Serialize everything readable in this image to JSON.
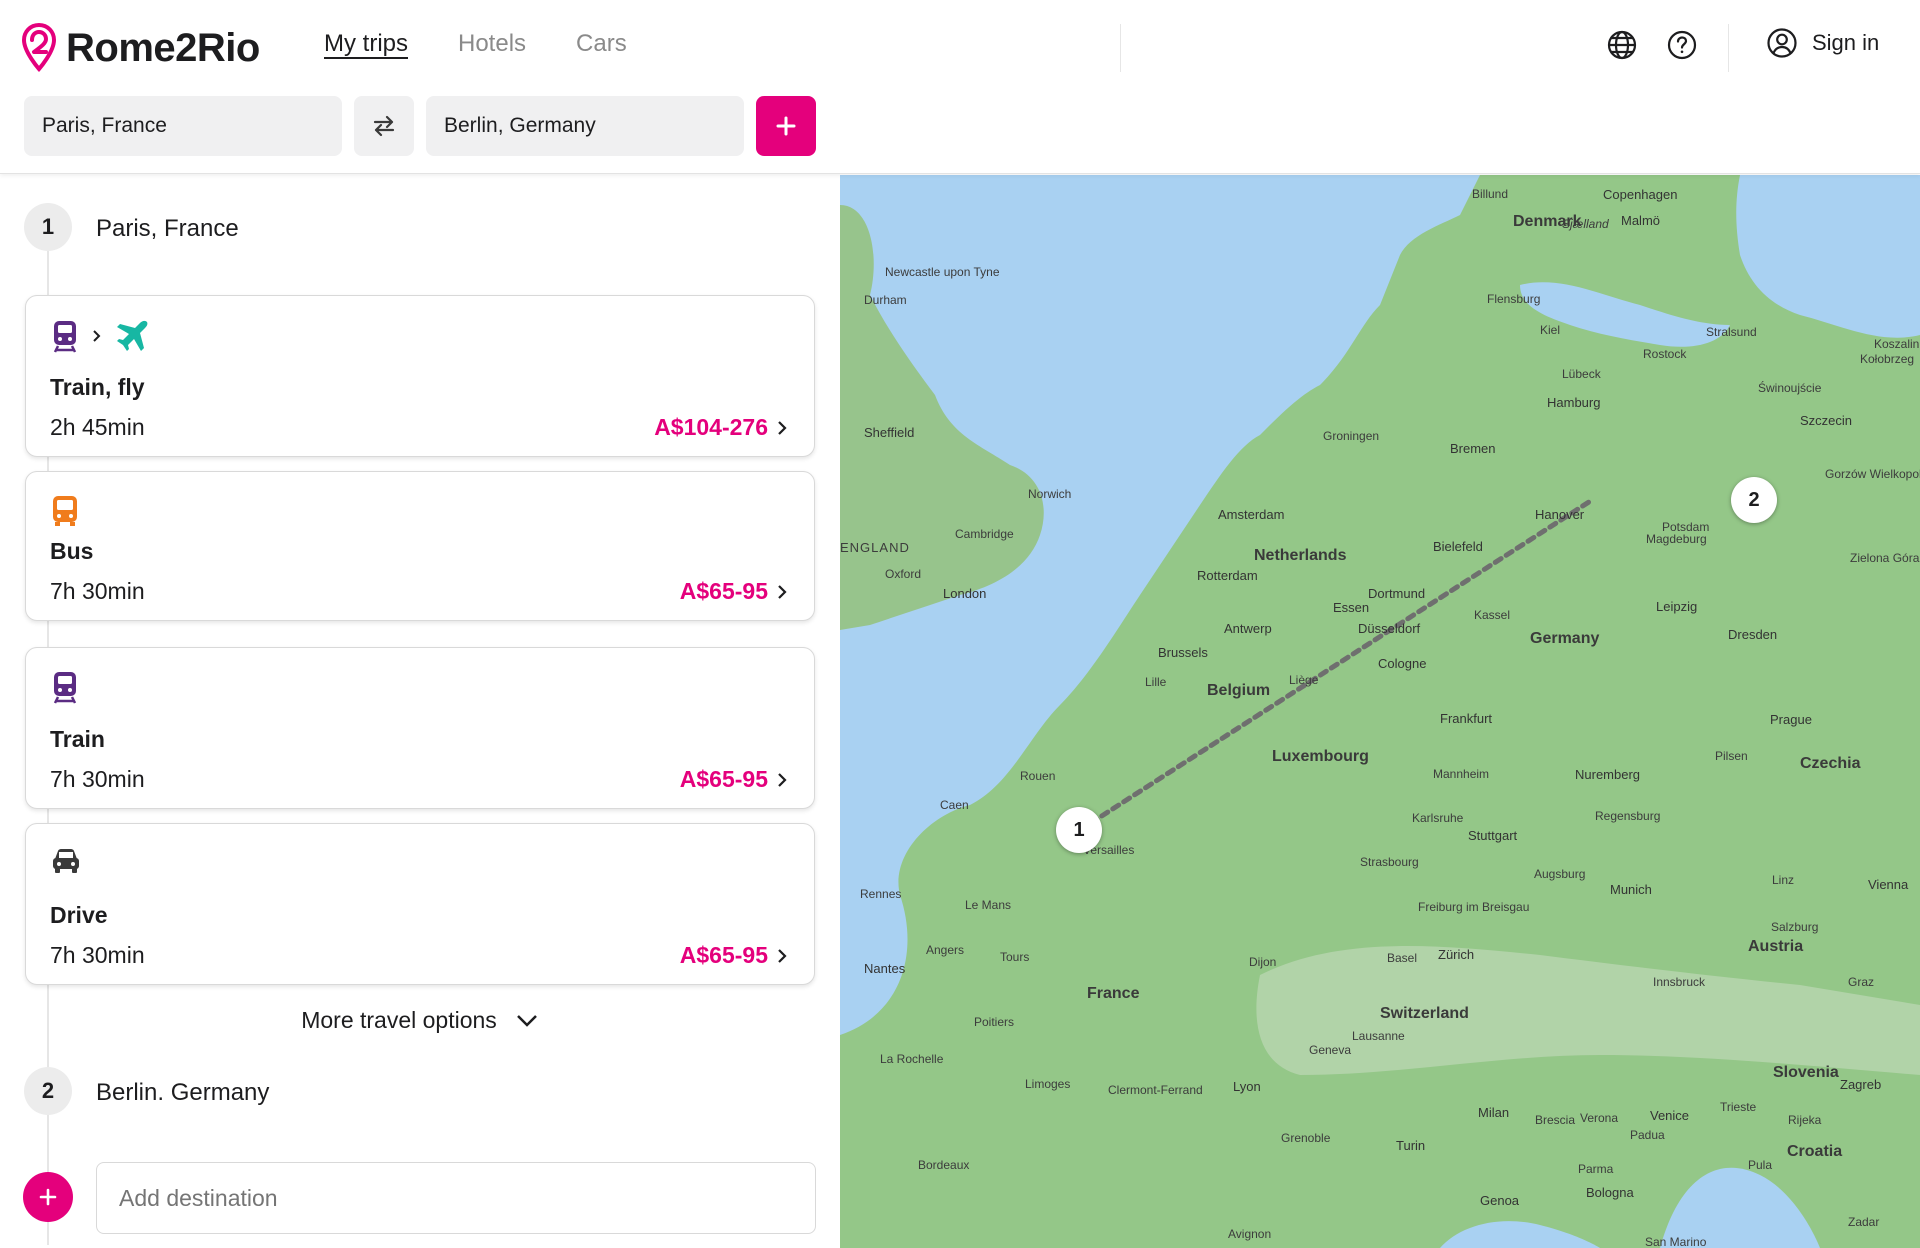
{
  "brand": {
    "name": "Rome2Rio",
    "accent": "#e4007c"
  },
  "nav": [
    {
      "label": "My trips",
      "active": true
    },
    {
      "label": "Hotels",
      "active": false
    },
    {
      "label": "Cars",
      "active": false
    }
  ],
  "header": {
    "sign_in_label": "Sign in"
  },
  "search": {
    "origin_value": "Paris, France",
    "destination_value": "Berlin, Germany"
  },
  "itinerary": {
    "stops": [
      {
        "number": "1",
        "name": "Paris, France"
      },
      {
        "number": "2",
        "name": "Berlin. Germany"
      }
    ],
    "options": [
      {
        "mode": "Train, fly",
        "duration": "2h 45min",
        "price": "A$104-276",
        "icons": [
          "train-icon",
          "plane-icon"
        ]
      },
      {
        "mode": "Bus",
        "duration": "7h 30min",
        "price": "A$65-95",
        "icons": [
          "bus-icon"
        ]
      },
      {
        "mode": "Train",
        "duration": "7h 30min",
        "price": "A$65-95",
        "icons": [
          "train-icon"
        ]
      },
      {
        "mode": "Drive",
        "duration": "7h 30min",
        "price": "A$65-95",
        "icons": [
          "car-icon"
        ]
      }
    ],
    "more_options_label": "More travel options",
    "add_destination_placeholder": "Add destination"
  },
  "map": {
    "pins": [
      "1",
      "2"
    ],
    "countries": [
      "Denmark",
      "Netherlands",
      "Belgium",
      "Luxembourg",
      "Germany",
      "Czechia",
      "France",
      "Switzerland",
      "Austria",
      "Slovenia",
      "Croatia",
      "ENGLAND"
    ],
    "cities": [
      "Copenhagen",
      "Malmö",
      "Billund",
      "Sjælland",
      "Newcastle upon Tyne",
      "Durham",
      "Flensburg",
      "Kiel",
      "Stralsund",
      "Rostock",
      "Koszalin",
      "Kołobrzeg",
      "Świnoujście",
      "Szczecin",
      "Lübeck",
      "Hamburg",
      "Sheffield",
      "Groningen",
      "Bremen",
      "Gorzów Wielkopolski",
      "Norwich",
      "Amsterdam",
      "Hanover",
      "Magdeburg",
      "Potsdam",
      "Cambridge",
      "Bielefeld",
      "Rotterdam",
      "Oxford",
      "London",
      "Dortmund",
      "Essen",
      "Kassel",
      "Leipzig",
      "Zielona Góra",
      "Antwerp",
      "Düsseldorf",
      "Dresden",
      "Brussels",
      "Cologne",
      "Lille",
      "Liège",
      "Frankfurt",
      "Prague",
      "Rouen",
      "Caen",
      "Mannheim",
      "Nuremberg",
      "Pilsen",
      "Versailles",
      "Karlsruhe",
      "Regensburg",
      "Stuttgart",
      "Strasbourg",
      "Rennes",
      "Le Mans",
      "Augsburg",
      "Munich",
      "Linz",
      "Vienna",
      "Freiburg im Breisgau",
      "Angers",
      "Tours",
      "Nantes",
      "Zürich",
      "Basel",
      "Salzburg",
      "Dijon",
      "Innsbruck",
      "Graz",
      "Poitiers",
      "Lausanne",
      "Geneva",
      "La Rochelle",
      "Limoges",
      "Clermont-Ferrand",
      "Lyon",
      "Milan",
      "Brescia",
      "Verona",
      "Venice",
      "Trieste",
      "Zagreb",
      "Rijeka",
      "Grenoble",
      "Turin",
      "Padua",
      "Bordeaux",
      "Parma",
      "Pula",
      "Bologna",
      "Genoa",
      "Zadar",
      "Avignon",
      "San Marino"
    ]
  }
}
